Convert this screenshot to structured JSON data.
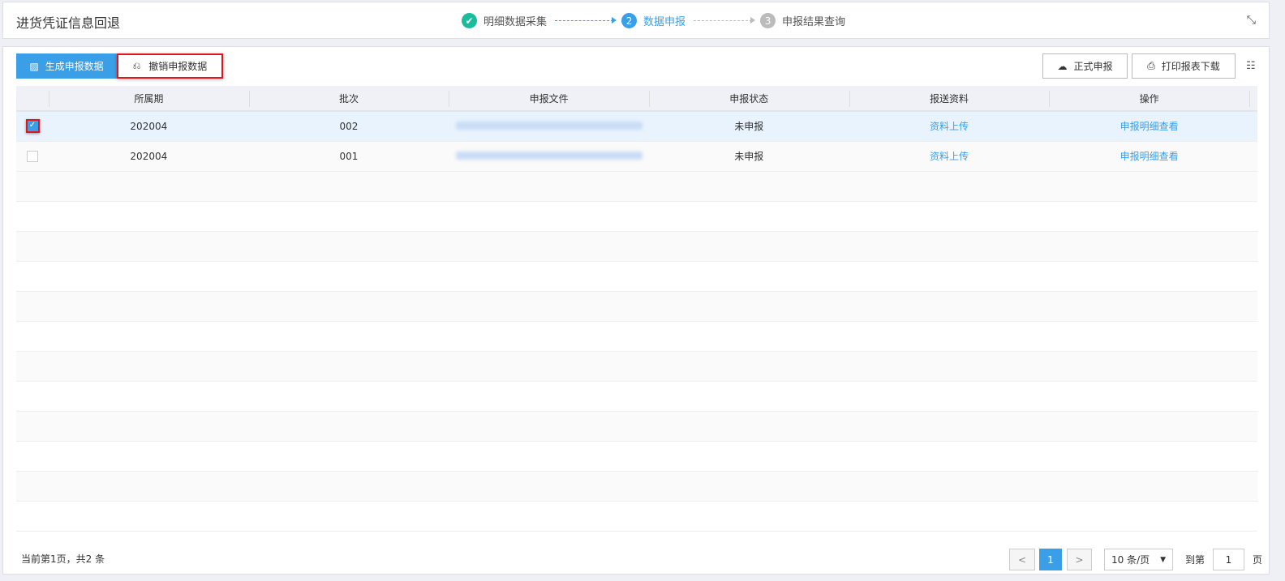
{
  "header": {
    "title": "进货凭证信息回退",
    "steps": [
      {
        "num": "✔",
        "label": "明细数据采集",
        "state": "done"
      },
      {
        "num": "2",
        "label": "数据申报",
        "state": "active"
      },
      {
        "num": "3",
        "label": "申报结果查询",
        "state": "pending"
      }
    ]
  },
  "toolbar": {
    "generate": "生成申报数据",
    "cancel": "撤销申报数据",
    "formal": "正式申报",
    "print": "打印报表下载"
  },
  "table": {
    "headers": [
      "所属期",
      "批次",
      "申报文件",
      "申报状态",
      "报送资料",
      "操作"
    ],
    "rows": [
      {
        "selected": true,
        "period": "202004",
        "batch": "002",
        "status": "未申报",
        "upload": "资料上传",
        "action": "申报明细查看"
      },
      {
        "selected": false,
        "period": "202004",
        "batch": "001",
        "status": "未申报",
        "upload": "资料上传",
        "action": "申报明细查看"
      }
    ]
  },
  "footer": {
    "info": "当前第1页，共2 条",
    "page": "1",
    "page_size": "10 条/页",
    "goto_label": "到第",
    "goto_value": "1",
    "goto_suffix": "页"
  },
  "colors": {
    "accent": "#3b9fe8",
    "done": "#1bbc9b",
    "highlight": "#e0161d"
  }
}
